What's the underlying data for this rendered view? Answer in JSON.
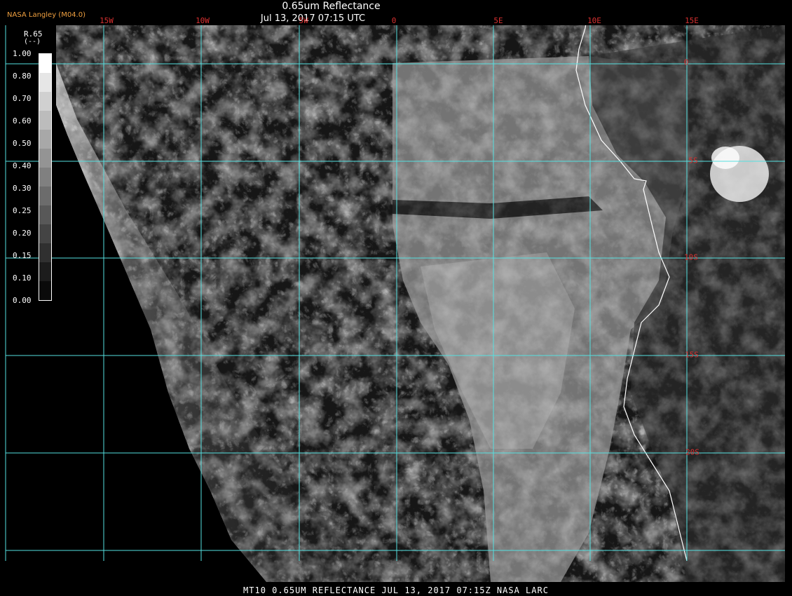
{
  "header": {
    "title": "0.65um Reflectance",
    "subtitle": "Jul 13, 2017 07:15 UTC",
    "credit": "NASA Langley (M04.0)"
  },
  "footer": {
    "text": "MT10  0.65UM REFLECTANCE  JUL 13, 2017 07:15Z  NASA LARC"
  },
  "legend": {
    "variable": "R.65",
    "unit": "(--)",
    "ticks": [
      "1.00",
      "0.80",
      "0.70",
      "0.60",
      "0.50",
      "0.40",
      "0.30",
      "0.25",
      "0.20",
      "0.15",
      "0.10",
      "0.00"
    ],
    "swatch_grays": [
      "#ffffff",
      "#e6e6e6",
      "#d0d0d0",
      "#bcbcbc",
      "#a8a8a8",
      "#949494",
      "#808080",
      "#6c6c6c",
      "#585858",
      "#444444",
      "#303030",
      "#1c1c1c",
      "#0a0a0a"
    ]
  },
  "grid": {
    "color": "#55e0e0",
    "label_color": "#d83030",
    "longitudes": [
      "15W",
      "10W",
      "5W",
      "0",
      "5E",
      "10E",
      "15E"
    ],
    "latitudes": [
      "0",
      "5S",
      "10S",
      "15S",
      "20S"
    ]
  }
}
